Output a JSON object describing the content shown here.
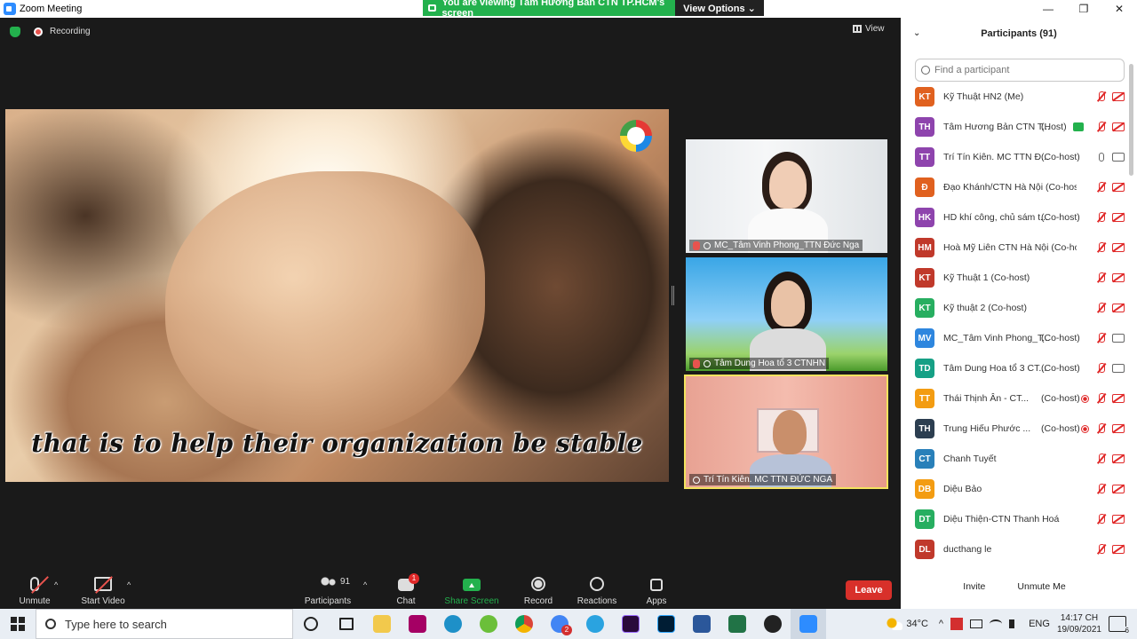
{
  "window": {
    "title": "Zoom Meeting"
  },
  "banner": {
    "text": "You are viewing Tâm Hương Bản CTN TP.HCM's screen",
    "view_options": "View Options ⌄"
  },
  "meeting": {
    "recording_label": "Recording",
    "view_label": "View"
  },
  "shared_screen": {
    "caption": "that is to help their organization be stable"
  },
  "tiles": [
    {
      "name": "MC_Tâm Vinh Phong_TTN Đức Nga"
    },
    {
      "name": "Tâm Dung Hoa tổ 3 CTNHN"
    },
    {
      "name": "Trí Tín Kiên. MC  TTN ĐỨC NGA"
    }
  ],
  "toolbar": {
    "unmute": "Unmute",
    "start_video": "Start Video",
    "participants": "Participants",
    "participants_count": "91",
    "chat": "Chat",
    "chat_badge": "1",
    "share_screen": "Share Screen",
    "record": "Record",
    "reactions": "Reactions",
    "apps": "Apps",
    "leave": "Leave"
  },
  "panel": {
    "title": "Participants (91)",
    "search_placeholder": "Find a participant",
    "invite": "Invite",
    "unmute_me": "Unmute Me",
    "participants": [
      {
        "initials": "KT",
        "color": "#e0611f",
        "name": "Kỹ Thuật HN2 (Me)",
        "role": "",
        "status": "muted"
      },
      {
        "initials": "TH",
        "color": "#8e44ad",
        "name": "Tâm Hương Bản CTN T...",
        "role": "(Host)",
        "status": "muted",
        "sharing": true
      },
      {
        "initials": "TT",
        "color": "#8e44ad",
        "name": "Trí Tín Kiên. MC  TTN Đ...",
        "role": "(Co-host)",
        "status": "on"
      },
      {
        "initials": "Đ",
        "color": "#e0611f",
        "name": "Đạo Khánh/CTN Hà Nội (Co-host)",
        "role": "",
        "status": "muted"
      },
      {
        "initials": "HK",
        "color": "#8e44ad",
        "name": "HD khí công, chủ sám t...",
        "role": "(Co-host)",
        "status": "muted"
      },
      {
        "initials": "HM",
        "color": "#c0392b",
        "name": "Hoà Mỹ Liên CTN Hà Nội (Co-host)",
        "role": "",
        "status": "muted"
      },
      {
        "initials": "KT",
        "color": "#c0392b",
        "name": "Kỹ Thuật 1 (Co-host)",
        "role": "",
        "status": "muted"
      },
      {
        "initials": "KT",
        "color": "#27ae60",
        "name": "Kỹ thuật 2 (Co-host)",
        "role": "",
        "status": "muted"
      },
      {
        "initials": "MV",
        "color": "#2e86de",
        "name": "MC_Tâm Vinh Phong_T...",
        "role": "(Co-host)",
        "status": "muted-cam-on"
      },
      {
        "initials": "TD",
        "color": "#16a085",
        "name": "Tâm Dung Hoa tổ 3 CT...",
        "role": "(Co-host)",
        "status": "muted-cam-on"
      },
      {
        "initials": "TT",
        "color": "#f39c12",
        "name": "Thái Thịnh Ân - CT...",
        "role": "(Co-host)",
        "status": "rec"
      },
      {
        "initials": "TH",
        "color": "#2c3e50",
        "name": "Trung Hiếu Phước ...",
        "role": "(Co-host)",
        "status": "rec"
      },
      {
        "initials": "CT",
        "color": "#2980b9",
        "name": "Chanh Tuyết",
        "role": "",
        "status": "muted"
      },
      {
        "initials": "DB",
        "color": "#f39c12",
        "name": "Diệu Bảo",
        "role": "",
        "status": "muted"
      },
      {
        "initials": "DT",
        "color": "#27ae60",
        "name": "Diệu Thiện-CTN Thanh Hoá",
        "role": "",
        "status": "muted"
      },
      {
        "initials": "DL",
        "color": "#c0392b",
        "name": "ducthang le",
        "role": "",
        "status": "muted"
      }
    ]
  },
  "taskbar": {
    "search_placeholder": "Type here to search",
    "chrome_badge": "2",
    "temperature": "34°C",
    "language": "ENG",
    "time": "14:17 CH",
    "date": "19/09/2021",
    "notifications": "6"
  }
}
